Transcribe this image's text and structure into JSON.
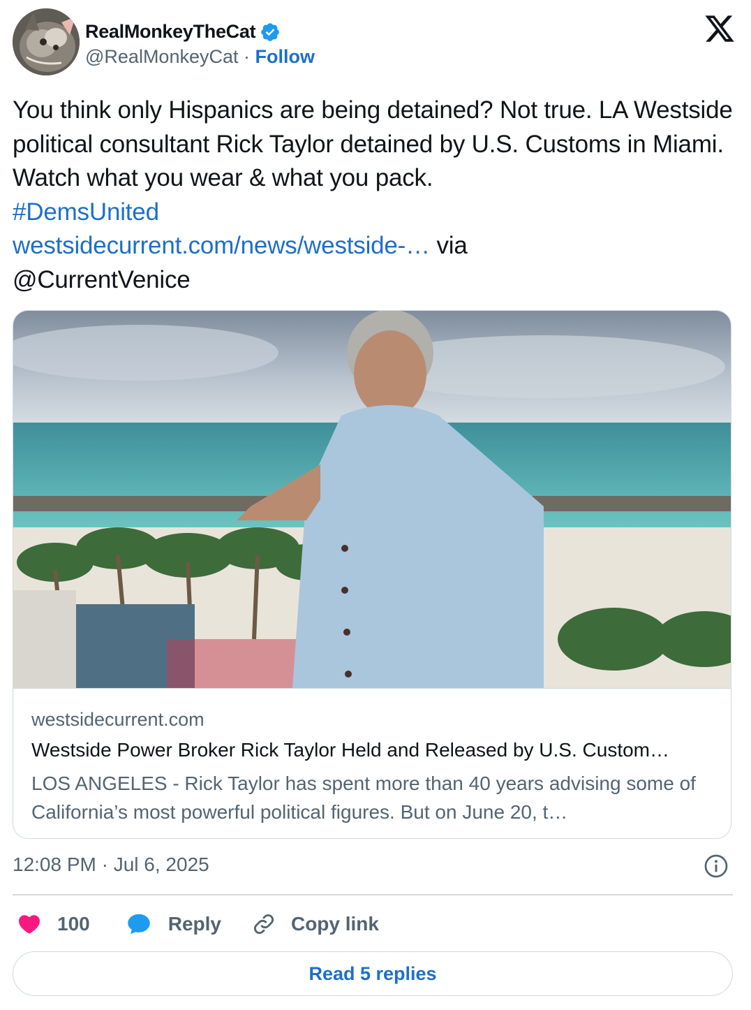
{
  "author": {
    "display_name": "RealMonkeyTheCat",
    "handle": "@RealMonkeyCat",
    "separator": "·",
    "follow_label": "Follow",
    "verified": true
  },
  "tweet": {
    "text_plain": "You think only Hispanics are being detained? Not true. LA Westside political consultant Rick Taylor detained by U.S. Customs in Miami. Watch what you wear & what you pack.",
    "hashtag": "#DemsUnited",
    "link": "westsidecurrent.com/news/westside-…",
    "via": "via",
    "mention": "@CurrentVenice"
  },
  "card": {
    "domain": "westsidecurrent.com",
    "title": "Westside Power Broker Rick Taylor Held and Released by U.S. Custom…",
    "description": "LOS ANGELES - Rick Taylor has spent more than 40 years advising some of California’s most powerful political figures. But on June 20, t…"
  },
  "meta": {
    "timestamp": "12:08 PM · Jul 6, 2025"
  },
  "actions": {
    "likes": "100",
    "reply_label": "Reply",
    "copy_label": "Copy link"
  },
  "read_replies_label": "Read 5 replies",
  "colors": {
    "link_blue": "#1d6fc8",
    "heart": "#f91880",
    "secondary_text": "#536471",
    "border": "#cfd9de"
  },
  "icons": [
    "verified-badge-icon",
    "x-logo-icon",
    "info-icon",
    "heart-icon",
    "reply-bubble-icon",
    "link-icon"
  ]
}
